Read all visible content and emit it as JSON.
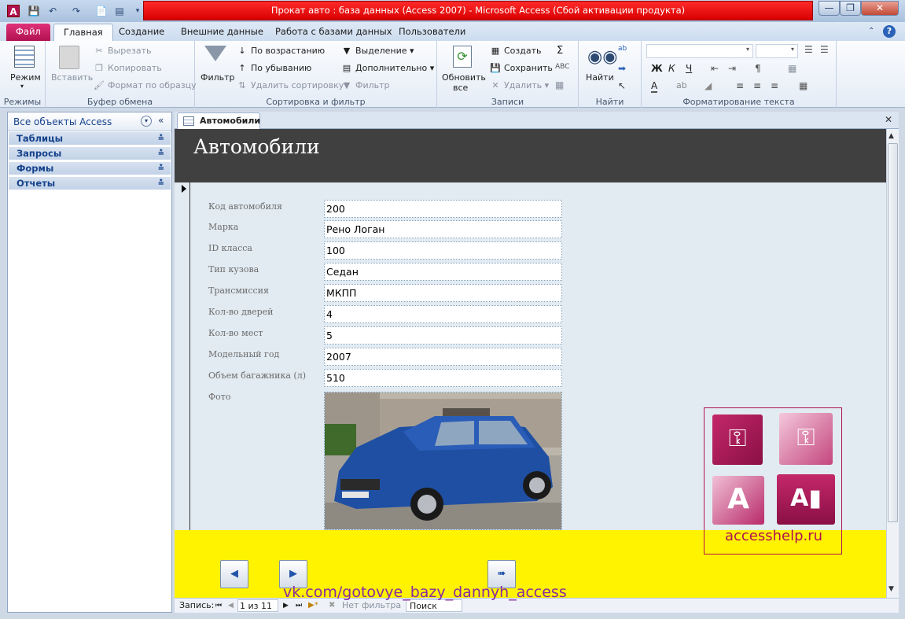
{
  "window": {
    "title": "Прокат авто : база данных (Access 2007)  -  Microsoft Access (Сбой активации продукта)"
  },
  "ribbon_tabs": [
    "Файл",
    "Главная",
    "Создание",
    "Внешние данные",
    "Работа с базами данных",
    "Пользователи"
  ],
  "ribbon": {
    "modes": {
      "view": "Режим",
      "label": "Режимы"
    },
    "clipboard": {
      "paste": "Вставить",
      "cut": "Вырезать",
      "copy": "Копировать",
      "format": "Формат по образцу",
      "label": "Буфер обмена"
    },
    "sort": {
      "filter": "Фильтр",
      "asc": "По возрастанию",
      "desc": "По убыванию",
      "remove": "Удалить сортировку",
      "selection": "Выделение",
      "advanced": "Дополнительно",
      "toggle": "Фильтр",
      "label": "Сортировка и фильтр"
    },
    "records": {
      "refresh": "Обновить",
      "refresh2": "все",
      "new": "Создать",
      "save": "Сохранить",
      "delete": "Удалить",
      "label": "Записи"
    },
    "find": {
      "find": "Найти",
      "label": "Найти"
    },
    "text": {
      "label": "Форматирование текста"
    }
  },
  "nav": {
    "header": "Все объекты Access",
    "groups": [
      "Таблицы",
      "Запросы",
      "Формы",
      "Отчеты"
    ]
  },
  "doc_tab": "Автомобили",
  "form": {
    "title": "Автомобили",
    "fields": [
      {
        "label": "Код автомобиля",
        "value": "200"
      },
      {
        "label": "Марка",
        "value": "Рено Логан"
      },
      {
        "label": "ID класса",
        "value": "100"
      },
      {
        "label": "Тип кузова",
        "value": "Седан"
      },
      {
        "label": "Трансмиссия",
        "value": "МКПП"
      },
      {
        "label": "Кол-во дверей",
        "value": "4"
      },
      {
        "label": "Кол-во мест",
        "value": "5"
      },
      {
        "label": "Модельный год",
        "value": "2007"
      },
      {
        "label": "Объем багажника (л)",
        "value": "510"
      }
    ],
    "photo_label": "Фото"
  },
  "status": {
    "record_label": "Запись:",
    "position": "1 из 11",
    "filter": "Нет фильтра",
    "search": "Поиск"
  },
  "watermark": {
    "site": "accesshelp.ru",
    "vk": "vk.com/gotovye_bazy_dannyh_access"
  },
  "colors": {
    "title_red": "#e00000",
    "form_header": "#404040",
    "footer": "#fff300",
    "detail_bg": "#e2ebf2"
  }
}
